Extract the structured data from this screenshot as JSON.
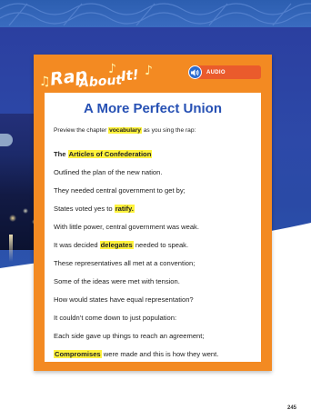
{
  "header": {
    "rap_word1": "Rap",
    "rap_word2": "About",
    "rap_word3": "It!",
    "audio_label": "AUDIO"
  },
  "content": {
    "title": "A More Perfect Union",
    "intro": {
      "before": "Preview the chapter ",
      "highlight": "vocabulary",
      "after": " as you sing the rap:"
    },
    "lines": [
      {
        "before": "The ",
        "highlight": "Articles of Confederation",
        "after": ""
      },
      {
        "before": "Outlined the plan of the new nation.",
        "highlight": "",
        "after": ""
      },
      {
        "before": "They needed central government to get by;",
        "highlight": "",
        "after": ""
      },
      {
        "before": "States voted yes to ",
        "highlight": "ratify.",
        "after": ""
      },
      {
        "before": "With little power, central government was weak.",
        "highlight": "",
        "after": ""
      },
      {
        "before": "It was decided ",
        "highlight": "delegates",
        "after": " needed to speak."
      },
      {
        "before": "These representatives all met at a convention;",
        "highlight": "",
        "after": ""
      },
      {
        "before": "Some of the ideas were met with tension.",
        "highlight": "",
        "after": ""
      },
      {
        "before": "How would states have equal representation?",
        "highlight": "",
        "after": ""
      },
      {
        "before": "It couldn’t come down to just population:",
        "highlight": "",
        "after": ""
      },
      {
        "before": "Each side gave up things to reach an agreement;",
        "highlight": "",
        "after": ""
      },
      {
        "before": "",
        "highlight": "Compromises",
        "after": " were made and this is how they went."
      }
    ]
  },
  "page_number": "245",
  "colors": {
    "card_orange": "#f38a22",
    "title_blue": "#2751b4",
    "highlight_yellow": "#fff23c",
    "audio_red": "#ea5b2c",
    "hero_blue": "#2d49a8"
  },
  "icons": [
    "music-note-icon",
    "speaker-icon"
  ]
}
